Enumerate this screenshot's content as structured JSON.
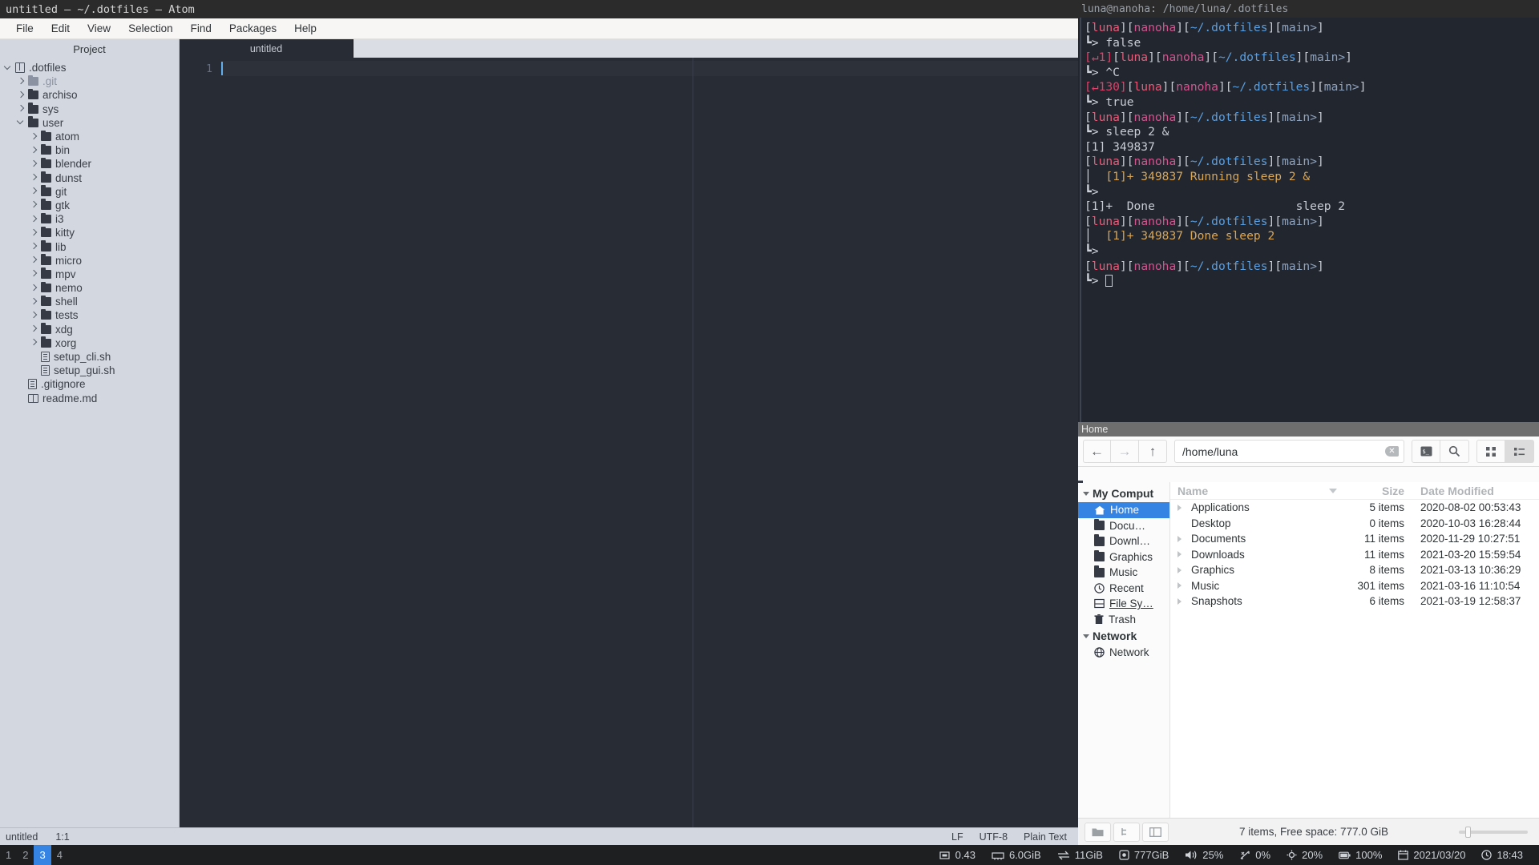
{
  "atom": {
    "title": "untitled — ~/.dotfiles — Atom",
    "menu": [
      "File",
      "Edit",
      "View",
      "Selection",
      "Find",
      "Packages",
      "Help"
    ],
    "tree_header": "Project",
    "tree": [
      {
        "label": ".dotfiles",
        "icon": "repo-icon",
        "indent": 0,
        "state": "open",
        "dim": false
      },
      {
        "label": ".git",
        "icon": "folder-icon",
        "indent": 1,
        "state": "closed",
        "dim": true
      },
      {
        "label": "archiso",
        "icon": "folder-icon",
        "indent": 1,
        "state": "closed",
        "dim": false
      },
      {
        "label": "sys",
        "icon": "folder-icon",
        "indent": 1,
        "state": "closed",
        "dim": false
      },
      {
        "label": "user",
        "icon": "folder-icon",
        "indent": 1,
        "state": "open",
        "dim": false
      },
      {
        "label": "atom",
        "icon": "folder-icon",
        "indent": 2,
        "state": "closed",
        "dim": false
      },
      {
        "label": "bin",
        "icon": "folder-icon",
        "indent": 2,
        "state": "closed",
        "dim": false
      },
      {
        "label": "blender",
        "icon": "folder-icon",
        "indent": 2,
        "state": "closed",
        "dim": false
      },
      {
        "label": "dunst",
        "icon": "folder-icon",
        "indent": 2,
        "state": "closed",
        "dim": false
      },
      {
        "label": "git",
        "icon": "folder-icon",
        "indent": 2,
        "state": "closed",
        "dim": false
      },
      {
        "label": "gtk",
        "icon": "folder-icon",
        "indent": 2,
        "state": "closed",
        "dim": false
      },
      {
        "label": "i3",
        "icon": "folder-icon",
        "indent": 2,
        "state": "closed",
        "dim": false
      },
      {
        "label": "kitty",
        "icon": "folder-icon",
        "indent": 2,
        "state": "closed",
        "dim": false
      },
      {
        "label": "lib",
        "icon": "folder-icon",
        "indent": 2,
        "state": "closed",
        "dim": false
      },
      {
        "label": "micro",
        "icon": "folder-icon",
        "indent": 2,
        "state": "closed",
        "dim": false
      },
      {
        "label": "mpv",
        "icon": "folder-icon",
        "indent": 2,
        "state": "closed",
        "dim": false
      },
      {
        "label": "nemo",
        "icon": "folder-icon",
        "indent": 2,
        "state": "closed",
        "dim": false
      },
      {
        "label": "shell",
        "icon": "folder-icon",
        "indent": 2,
        "state": "closed",
        "dim": false
      },
      {
        "label": "tests",
        "icon": "folder-icon",
        "indent": 2,
        "state": "closed",
        "dim": false
      },
      {
        "label": "xdg",
        "icon": "folder-icon",
        "indent": 2,
        "state": "closed",
        "dim": false
      },
      {
        "label": "xorg",
        "icon": "folder-icon",
        "indent": 2,
        "state": "closed",
        "dim": false
      },
      {
        "label": "setup_cli.sh",
        "icon": "file-icon",
        "indent": 2,
        "state": "none",
        "dim": false
      },
      {
        "label": "setup_gui.sh",
        "icon": "file-icon",
        "indent": 2,
        "state": "none",
        "dim": false
      },
      {
        "label": ".gitignore",
        "icon": "file-icon",
        "indent": 1,
        "state": "none",
        "dim": false
      },
      {
        "label": "readme.md",
        "icon": "book-icon",
        "indent": 1,
        "state": "none",
        "dim": false
      }
    ],
    "tab_label": "untitled",
    "line_number": "1",
    "status": {
      "file": "untitled",
      "cursor": "1:1",
      "line_ending": "LF",
      "encoding": "UTF-8",
      "grammar": "Plain Text"
    }
  },
  "terminal": {
    "title": "luna@nanoha: /home/luna/.dotfiles",
    "user": "luna",
    "host": "nanoha",
    "path": "~/.dotfiles",
    "branch": "main>",
    "lines": [
      {
        "type": "prompt",
        "exit": ""
      },
      {
        "type": "command",
        "text": "false"
      },
      {
        "type": "prompt",
        "exit": "1"
      },
      {
        "type": "command",
        "text": "^C"
      },
      {
        "type": "prompt",
        "exit": "130"
      },
      {
        "type": "command",
        "text": "true"
      },
      {
        "type": "prompt",
        "exit": ""
      },
      {
        "type": "command",
        "text": "sleep 2 &"
      },
      {
        "type": "output",
        "text": "[1] 349837"
      },
      {
        "type": "prompt",
        "exit": ""
      },
      {
        "type": "job",
        "text": "[1]+ 349837 Running sleep 2 &"
      },
      {
        "type": "bare",
        "text": ""
      },
      {
        "type": "output",
        "text": "[1]+  Done                    sleep 2"
      },
      {
        "type": "prompt",
        "exit": ""
      },
      {
        "type": "job",
        "text": "[1]+ 349837 Done sleep 2"
      },
      {
        "type": "bare",
        "text": ""
      },
      {
        "type": "prompt",
        "exit": ""
      },
      {
        "type": "cursor",
        "text": ""
      }
    ]
  },
  "filemanager": {
    "title": "Home",
    "path_value": "/home/luna",
    "toolbar": {
      "back": "back-arrow",
      "forward": "forward-arrow",
      "up": "up-arrow",
      "clear": "clear-icon",
      "terminal": "terminal-icon",
      "search": "search-icon",
      "icon_view": "grid-view-icon",
      "list_view": "list-view-icon"
    },
    "places_header": "My Comput",
    "network_header": "Network",
    "places": [
      {
        "label": "Home",
        "icon": "home-icon",
        "selected": true,
        "underline": false
      },
      {
        "label": "Docu…",
        "icon": "folder-icon",
        "selected": false,
        "underline": false
      },
      {
        "label": "Downl…",
        "icon": "folder-icon",
        "selected": false,
        "underline": false
      },
      {
        "label": "Graphics",
        "icon": "folder-icon",
        "selected": false,
        "underline": false
      },
      {
        "label": "Music",
        "icon": "folder-icon",
        "selected": false,
        "underline": false
      },
      {
        "label": "Recent",
        "icon": "clock-icon",
        "selected": false,
        "underline": false
      },
      {
        "label": "File Sy…",
        "icon": "drive-icon",
        "selected": false,
        "underline": true
      },
      {
        "label": "Trash",
        "icon": "trash-icon",
        "selected": false,
        "underline": false
      }
    ],
    "network_items": [
      {
        "label": "Network",
        "icon": "globe-icon"
      }
    ],
    "columns": [
      "Name",
      "Size",
      "Date Modified"
    ],
    "rows": [
      {
        "name": "Applications",
        "size": "5 items",
        "date": "2020-08-02 00:53:43",
        "expandable": true
      },
      {
        "name": "Desktop",
        "size": "0 items",
        "date": "2020-10-03 16:28:44",
        "expandable": false
      },
      {
        "name": "Documents",
        "size": "11 items",
        "date": "2020-11-29 10:27:51",
        "expandable": true
      },
      {
        "name": "Downloads",
        "size": "11 items",
        "date": "2021-03-20 15:59:54",
        "expandable": true
      },
      {
        "name": "Graphics",
        "size": "8 items",
        "date": "2021-03-13 10:36:29",
        "expandable": true
      },
      {
        "name": "Music",
        "size": "301 items",
        "date": "2021-03-16 11:10:54",
        "expandable": true
      },
      {
        "name": "Snapshots",
        "size": "6 items",
        "date": "2021-03-19 12:58:37",
        "expandable": true
      }
    ],
    "status_text": "7 items, Free space: 777.0 GiB"
  },
  "i3bar": {
    "workspaces": [
      {
        "label": "1",
        "active": false
      },
      {
        "label": "2",
        "active": false
      },
      {
        "label": "3",
        "active": true
      },
      {
        "label": "4",
        "active": false
      }
    ],
    "accent": "#3584e4",
    "blocks": [
      {
        "icon": "cpu-icon",
        "value": "0.43"
      },
      {
        "icon": "memory-icon",
        "value": "6.0GiB"
      },
      {
        "icon": "swap-icon",
        "value": "11GiB"
      },
      {
        "icon": "disk-icon",
        "value": "777GiB"
      },
      {
        "icon": "volume-icon",
        "value": "25%"
      },
      {
        "icon": "brightness-icon",
        "value": "0%"
      },
      {
        "icon": "gear-icon",
        "value": "20%"
      },
      {
        "icon": "battery-icon",
        "value": "100%"
      },
      {
        "icon": "calendar-icon",
        "value": "2021/03/20"
      },
      {
        "icon": "clock-icon",
        "value": "18:43"
      }
    ]
  }
}
